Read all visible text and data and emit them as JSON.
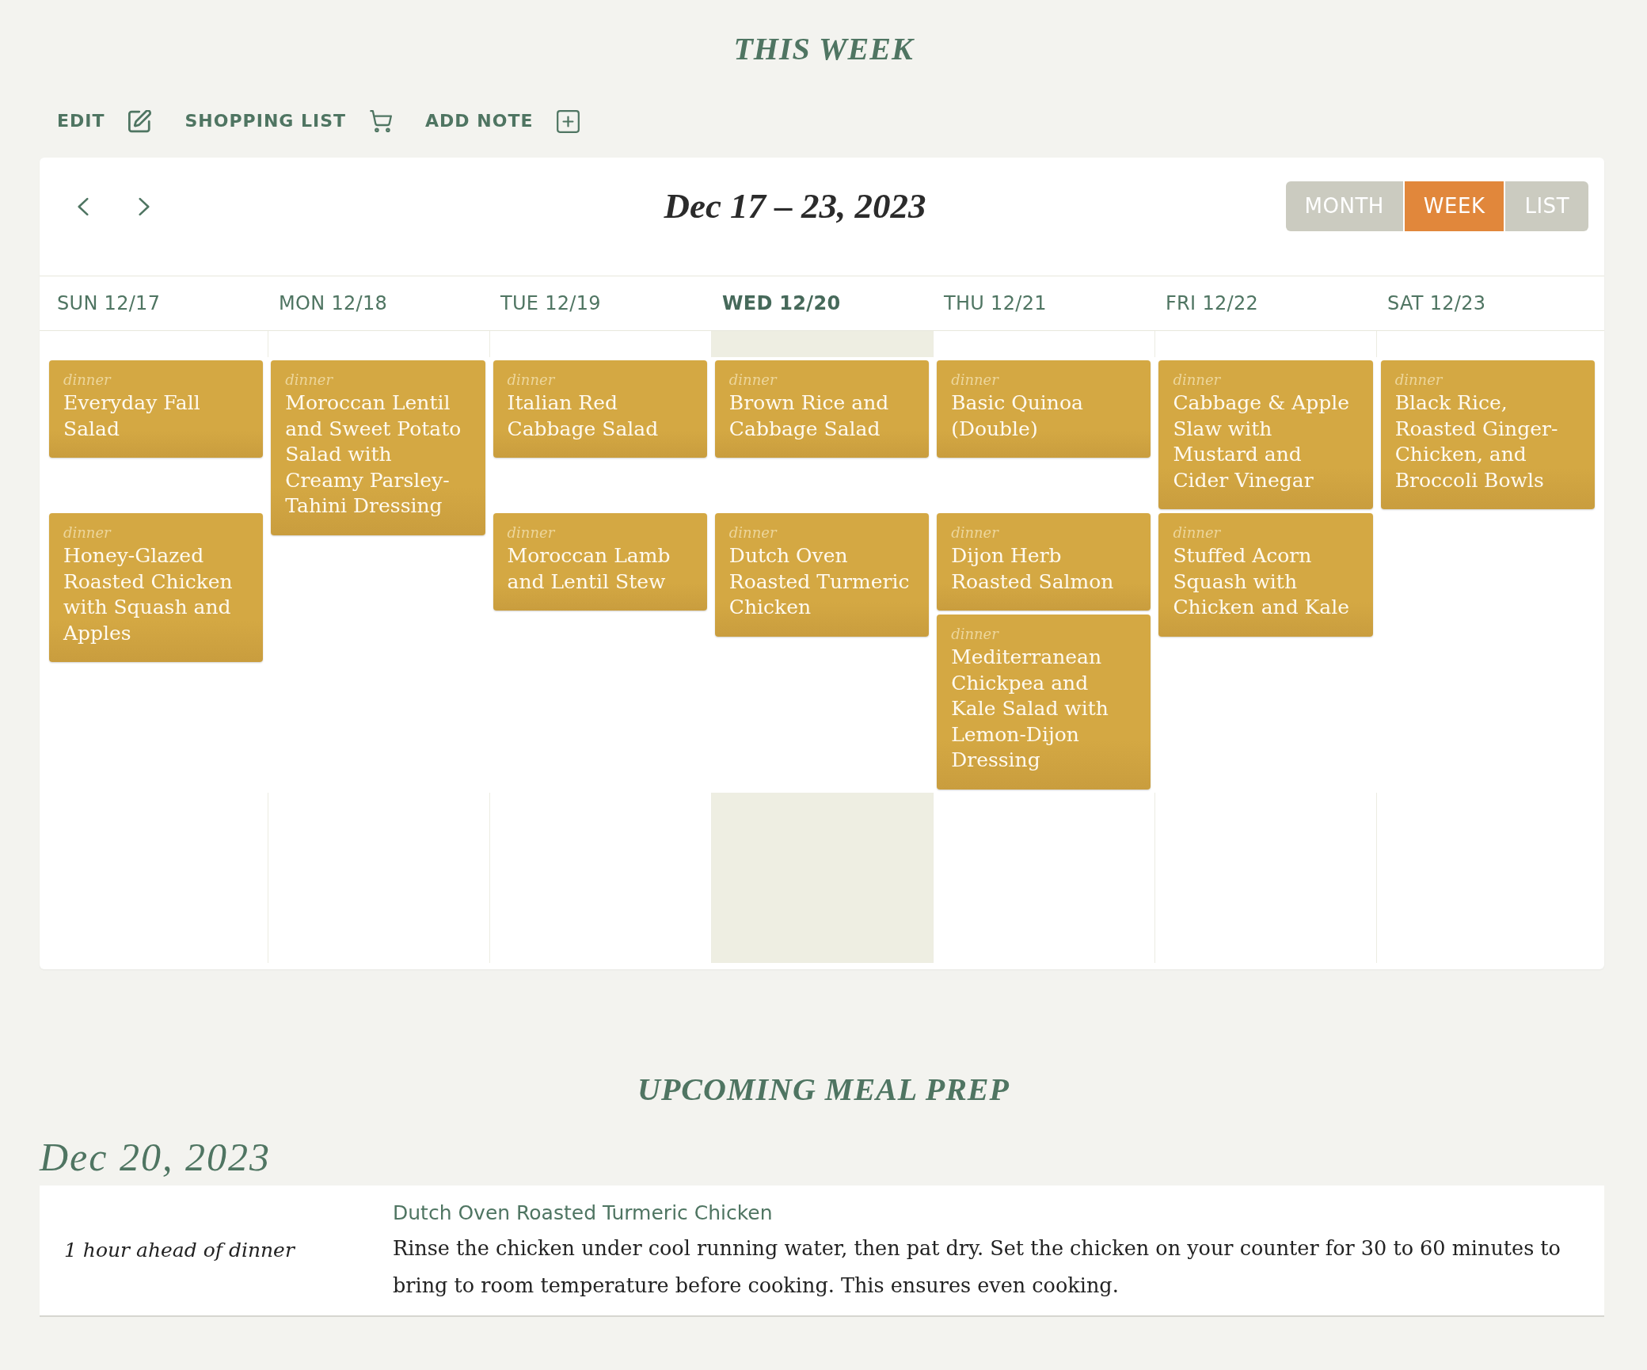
{
  "page_title": "THIS WEEK",
  "toolbar": [
    {
      "label": "EDIT",
      "kind": "edit"
    },
    {
      "label": "SHOPPING LIST",
      "kind": "cart"
    },
    {
      "label": "ADD NOTE",
      "kind": "add"
    }
  ],
  "calendar": {
    "title": "Dec 17 – 23, 2023",
    "views": [
      {
        "label": "MONTH",
        "selected": false
      },
      {
        "label": "WEEK",
        "selected": true
      },
      {
        "label": "LIST",
        "selected": false
      }
    ],
    "days": [
      {
        "label": "SUN 12/17",
        "today": false,
        "events": [
          {
            "meal": "dinner",
            "title": "Everyday Fall Salad"
          },
          {
            "meal": "dinner",
            "title": "Honey-Glazed Roasted Chicken with Squash and Apples"
          }
        ]
      },
      {
        "label": "MON 12/18",
        "today": false,
        "events": [
          {
            "meal": "dinner",
            "title": "Moroccan Lentil and Sweet Potato Salad with Creamy Parsley-Tahini Dressing"
          }
        ]
      },
      {
        "label": "TUE 12/19",
        "today": false,
        "events": [
          {
            "meal": "dinner",
            "title": "Italian Red Cabbage Salad"
          },
          {
            "meal": "dinner",
            "title": "Moroccan Lamb and Lentil Stew"
          }
        ]
      },
      {
        "label": "WED 12/20",
        "today": true,
        "events": [
          {
            "meal": "dinner",
            "title": "Brown Rice and Cabbage Salad"
          },
          {
            "meal": "dinner",
            "title": "Dutch Oven Roasted Turmeric Chicken"
          }
        ]
      },
      {
        "label": "THU 12/21",
        "today": false,
        "events": [
          {
            "meal": "dinner",
            "title": "Basic Quinoa (Double)"
          },
          {
            "meal": "dinner",
            "title": "Dijon Herb Roasted Salmon"
          },
          {
            "meal": "dinner",
            "title": "Mediterranean Chickpea and Kale Salad with Lemon-Dijon Dressing"
          }
        ]
      },
      {
        "label": "FRI 12/22",
        "today": false,
        "events": [
          {
            "meal": "dinner",
            "title": "Cabbage & Apple Slaw with Mustard and Cider Vinegar"
          },
          {
            "meal": "dinner",
            "title": "Stuffed Acorn Squash with Chicken and Kale"
          }
        ]
      },
      {
        "label": "SAT 12/23",
        "today": false,
        "events": [
          {
            "meal": "dinner",
            "title": "Black Rice, Roasted Ginger-Chicken, and Broccoli Bowls"
          }
        ]
      }
    ]
  },
  "meal_prep": {
    "title": "UPCOMING MEAL PREP",
    "date": "Dec 20, 2023",
    "items": [
      {
        "timing": "1 hour ahead of dinner",
        "recipe": "Dutch Oven Roasted Turmeric Chicken",
        "instructions": "Rinse the chicken under cool running water, then pat dry. Set the chicken on your counter for 30 to 60 minutes to bring to room temperature before cooking. This ensures even cooking."
      }
    ]
  }
}
